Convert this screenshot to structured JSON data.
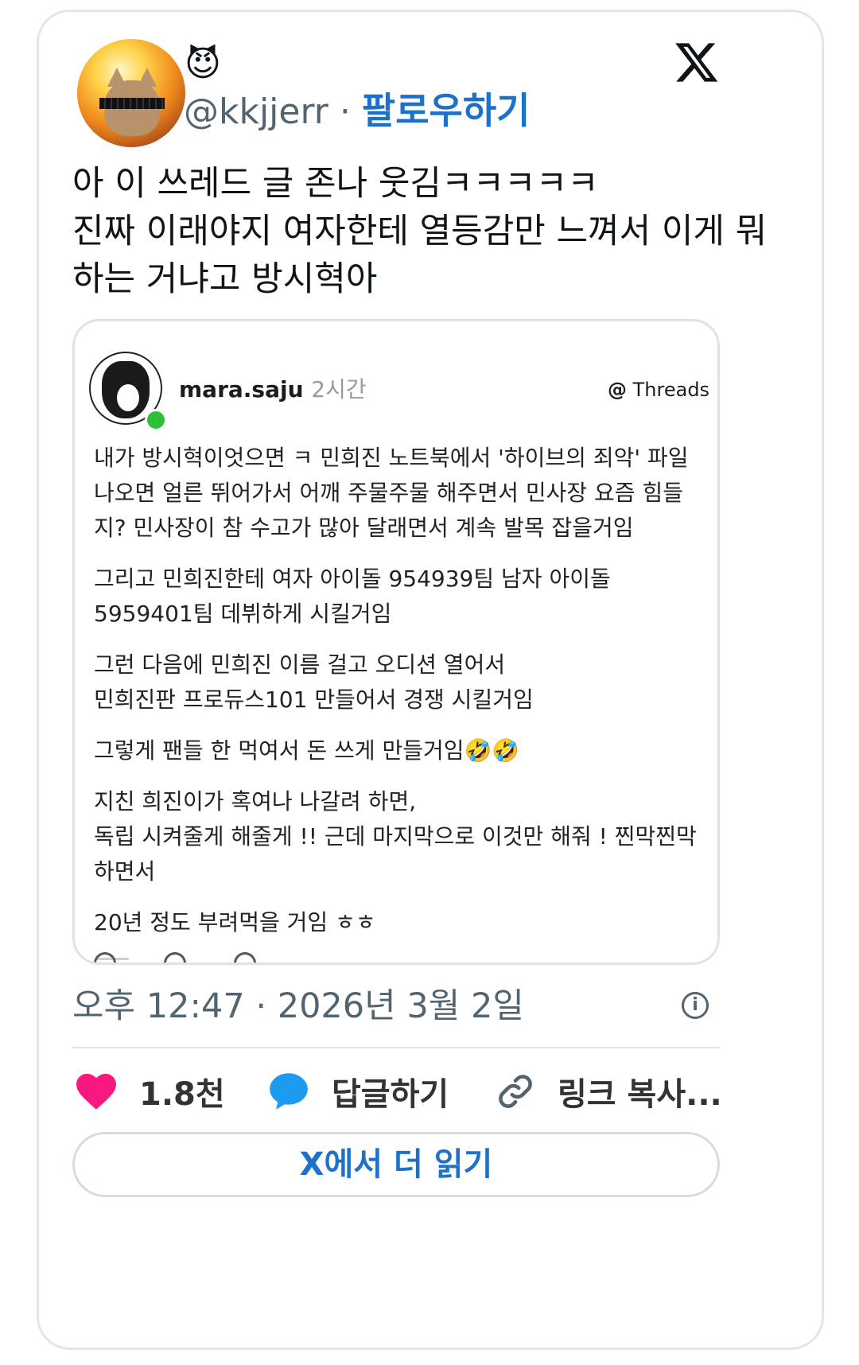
{
  "author": {
    "emoji": "😈",
    "handle": "@kkjjerr",
    "separator": "·",
    "follow_label": "팔로우하기"
  },
  "tweet": {
    "text": "아 이 쓰레드 글 존나 웃김ㅋㅋㅋㅋㅋ\n진짜 이래야지 여자한테 열등감만 느껴서 이게 뭐하는 거냐고 방시혁아"
  },
  "embed": {
    "username": "mara.saju",
    "time": "2시간",
    "brand_glyph": "@",
    "brand_label": "Threads",
    "paragraphs": [
      "내가 방시혁이엇으면 ㅋ 민희진 노트북에서 '하이브의 죄악' 파일 나오면 얼른 뛰어가서 어깨 주물주물 해주면서 민사장 요즘 힘들지? 민사장이 참 수고가 많아 달래면서 계속 발목 잡을거임",
      "그리고 민희진한테 여자 아이돌 954939팀 남자 아이돌 5959401팀 데뷔하게 시킬거임",
      "그런 다음에 민희진 이름 걸고 오디션 열어서\n민희진판 프로듀스101 만들어서 경쟁 시킬거임",
      "그렇게 팬들 한 먹여서 돈 쓰게 만들거임🤣🤣",
      "지친 희진이가 혹여나 나갈려 하면,\n독립 시켜줄게 해줄게 !! 근데 마지막으로 이것만 해줘 ! 찐막찐막 하면서",
      "20년 정도 부려먹을 거임 ㅎㅎ"
    ]
  },
  "footer": {
    "timestamp": "오후 12:47 · 2026년 3월 2일",
    "info_glyph": "i",
    "likes": "1.8천",
    "reply_label": "답글하기",
    "link_label": "링크 복사...",
    "read_more": "X에서 더 읽기"
  },
  "colors": {
    "accent": "#1d71c8",
    "like": "#f91880",
    "reply": "#1d9bf0",
    "muted": "#536471"
  }
}
